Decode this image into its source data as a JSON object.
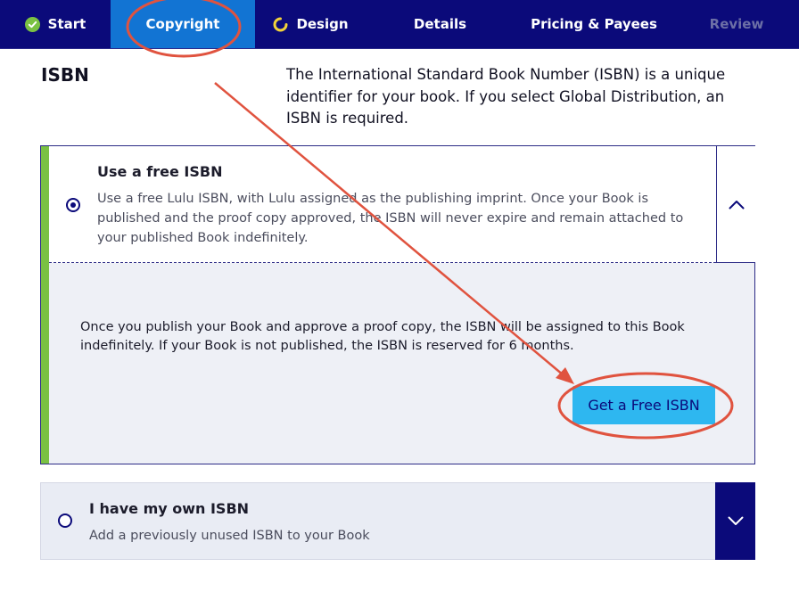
{
  "nav": {
    "tabs": [
      {
        "label": "Start",
        "state": "complete"
      },
      {
        "label": "Copyright",
        "state": "active"
      },
      {
        "label": "Design",
        "state": "in-progress"
      },
      {
        "label": "Details",
        "state": "pending"
      },
      {
        "label": "Pricing & Payees",
        "state": "pending"
      },
      {
        "label": "Review",
        "state": "disabled"
      }
    ]
  },
  "isbn": {
    "title": "ISBN",
    "description": "The International Standard Book Number (ISBN) is a unique identifier for your book. If you select Global Distribution, an ISBN is required."
  },
  "free_option": {
    "title": "Use a free ISBN",
    "description": "Use a free Lulu ISBN, with Lulu assigned as the publishing imprint. Once your Book is published and the proof copy approved, the ISBN will never expire and remain attached to your published Book indefinitely.",
    "selected": true,
    "expanded": true,
    "body": "Once you publish your Book and approve a proof copy, the ISBN will be assigned to this Book indefinitely. If your Book is not published, the ISBN is reserved for 6 months.",
    "button_label": "Get a Free ISBN"
  },
  "own_option": {
    "title": "I have my own ISBN",
    "description": "Add a previously unused ISBN to your Book",
    "selected": false,
    "expanded": false
  },
  "colors": {
    "nav_bg": "#0b0a7a",
    "active_tab": "#1274d3",
    "accent_green": "#7ac143",
    "button_bg": "#2eb7f0",
    "annotation_red": "#e0533f"
  },
  "icons": {
    "start": "check-circle-icon",
    "design": "progress-spinner-icon",
    "free_toggle": "chevron-up-icon",
    "own_toggle": "chevron-down-icon"
  }
}
